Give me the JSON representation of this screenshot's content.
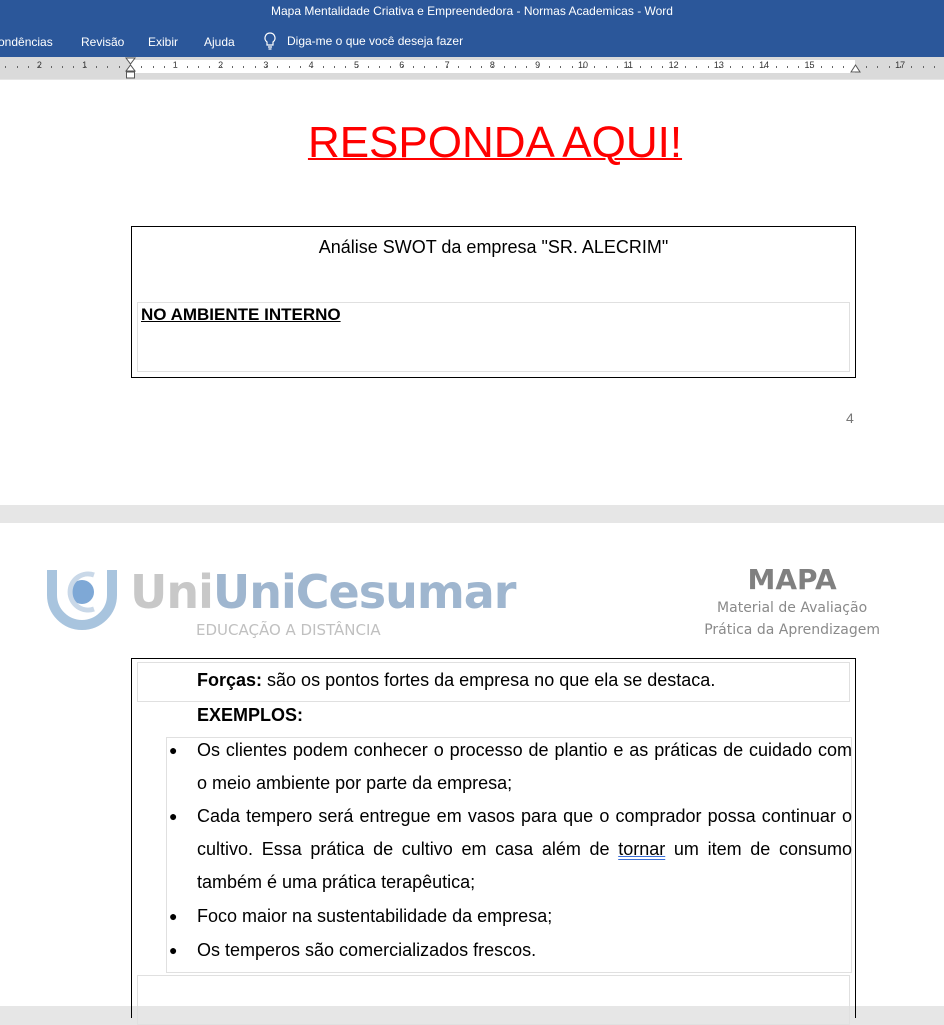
{
  "window": {
    "title": "Mapa Mentalidade Criativa e Empreendedora - Normas Academicas  -  Word"
  },
  "ribbon": {
    "tabs": [
      "ondências",
      "Revisão",
      "Exibir",
      "Ajuda"
    ],
    "tell_me": "Diga-me o que você deseja fazer"
  },
  "ruler": {
    "left_numbers": [
      "2",
      "1"
    ],
    "right_numbers": [
      "1",
      "2",
      "3",
      "4",
      "5",
      "6",
      "7",
      "8",
      "9",
      "10",
      "11",
      "12",
      "13",
      "14",
      "15",
      "",
      "17"
    ]
  },
  "page1": {
    "heading": "RESPONDA AQUI!",
    "table_title": "Análise SWOT da empresa \"SR. ALECRIM\"",
    "section": "NO AMBIENTE INTERNO",
    "page_number": "4"
  },
  "page2": {
    "logo": {
      "name": "UniCesumar",
      "tagline": "EDUCAÇÃO A DISTÂNCIA"
    },
    "mapa": {
      "title": "MAPA",
      "line1": "Material de Avaliação",
      "line2": "Prática da Aprendizagem"
    },
    "forcas_label": "Forças:",
    "forcas_text": " são os pontos fortes da empresa no que ela se destaca.",
    "examples_label": "EXEMPLOS:",
    "items": [
      {
        "text": "Os clientes podem conhecer o processo de plantio e as práticas de cuidado com o meio ambiente por parte da empresa;"
      },
      {
        "before": "Cada tempero será entregue em vasos para que o comprador possa continuar o cultivo. Essa prática de cultivo em casa além de ",
        "flagged": "tornar",
        "after": " um item de consumo também é uma prática terapêutica;"
      },
      {
        "text": "Foco maior na sustentabilidade da empresa;"
      },
      {
        "text": "Os temperos são comercializados frescos."
      }
    ]
  }
}
